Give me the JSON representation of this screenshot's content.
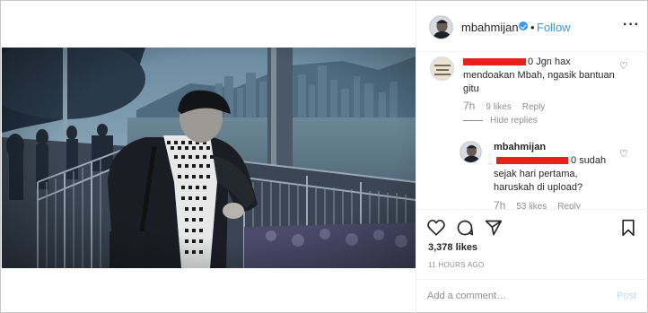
{
  "post": {
    "username": "mbahmijan",
    "separator": "•",
    "follow_label": "Follow",
    "more_icon": "more-icon",
    "photo_alt": "Man in black jacket and houndstooth scarf posing by a railing on a harbour promenade, city skyline in background"
  },
  "comments": [
    {
      "username_redacted": true,
      "username_suffix": "0",
      "text": "Jgn hax mendoakan Mbah, ngasik bantuan gitu",
      "time": "7h",
      "likes": "9 likes",
      "reply": "Reply",
      "hide_replies": "Hide replies"
    },
    {
      "username": "mbahmijan",
      "text_suffix": "0",
      "text": "sudah sejak hari pertama, haruskah di upload?",
      "time": "7h",
      "likes": "53 likes",
      "reply": "Reply"
    }
  ],
  "actions": {
    "like_icon": "heart-icon",
    "comment_icon": "comment-icon",
    "share_icon": "share-icon",
    "save_icon": "bookmark-icon",
    "likes_count": "3,378 likes",
    "time_ago": "11 HOURS AGO"
  },
  "add_comment": {
    "placeholder": "Add a comment…",
    "post_label": "Post"
  },
  "colors": {
    "accent": "#3897f0",
    "redaction": "#e8211d",
    "muted": "#8e8e8e",
    "post_disabled": "#b2dffc"
  }
}
